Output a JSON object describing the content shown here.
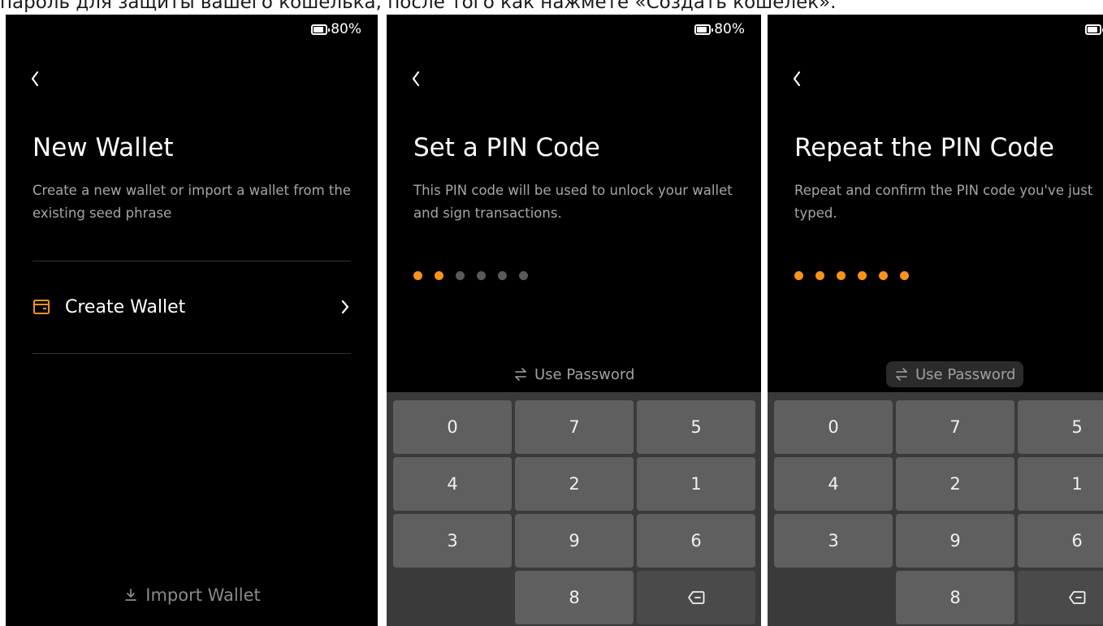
{
  "caption": "пароль для защиты вашего кошелька, после того как нажмете «Создать кошелек».",
  "status": {
    "battery": "80%"
  },
  "screen1": {
    "title": "New Wallet",
    "description": "Create a new wallet or import a wallet from the existing seed phrase",
    "create_label": "Create Wallet",
    "import_label": "Import Wallet"
  },
  "screen2": {
    "title": "Set a PIN Code",
    "description": "This PIN code will be used to unlock your wallet and sign transactions.",
    "pin_filled": 2,
    "pin_total": 6,
    "use_password": "Use Password"
  },
  "screen3": {
    "title": "Repeat the PIN Code",
    "description": "Repeat and confirm the PIN code you've just typed.",
    "pin_filled": 6,
    "pin_total": 6,
    "use_password": "Use Password"
  },
  "keypad": {
    "keys": [
      "0",
      "7",
      "5",
      "4",
      "2",
      "1",
      "3",
      "9",
      "6",
      "",
      "8",
      "backspace"
    ]
  },
  "colors": {
    "accent": "#f7931a",
    "background": "#000000",
    "key": "#5f5f5f"
  },
  "icons": [
    "battery-icon",
    "back-icon",
    "wallet-icon",
    "chevron-right-icon",
    "import-icon",
    "swap-icon",
    "backspace-icon"
  ]
}
